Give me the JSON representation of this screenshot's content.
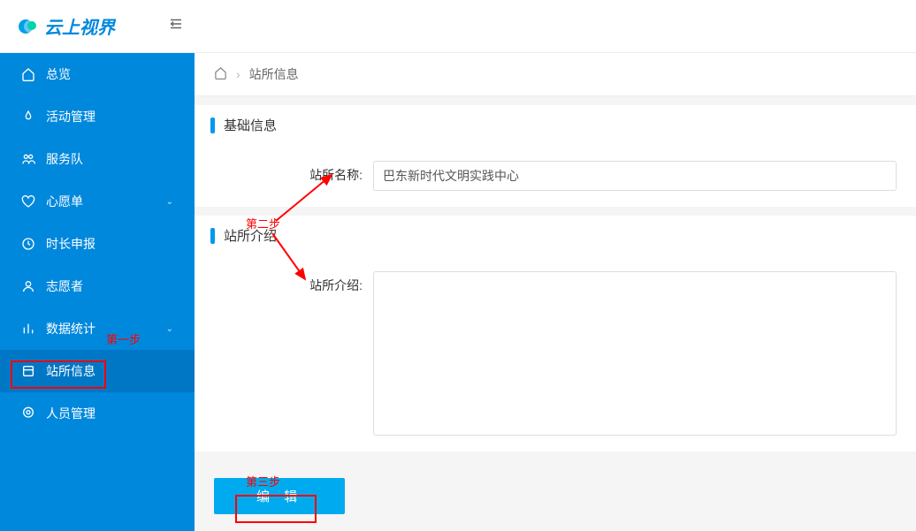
{
  "brand": {
    "name": "云上视界"
  },
  "sidebar": {
    "items": [
      {
        "label": "总览",
        "icon": "home-icon",
        "expandable": false
      },
      {
        "label": "活动管理",
        "icon": "fire-icon",
        "expandable": false
      },
      {
        "label": "服务队",
        "icon": "team-icon",
        "expandable": false
      },
      {
        "label": "心愿单",
        "icon": "heart-icon",
        "expandable": true
      },
      {
        "label": "时长申报",
        "icon": "clock-icon",
        "expandable": false
      },
      {
        "label": "志愿者",
        "icon": "user-icon",
        "expandable": false
      },
      {
        "label": "数据统计",
        "icon": "chart-icon",
        "expandable": true
      },
      {
        "label": "站所信息",
        "icon": "site-icon",
        "expandable": false
      },
      {
        "label": "人员管理",
        "icon": "people-icon",
        "expandable": false
      }
    ]
  },
  "breadcrumb": {
    "home": "⌂",
    "current": "站所信息"
  },
  "sections": {
    "basic_title": "基础信息",
    "intro_title": "站所介绍"
  },
  "form": {
    "name_label": "站所名称:",
    "name_value": "巴东新时代文明实践中心",
    "intro_label": "站所介绍:",
    "intro_value": ""
  },
  "actions": {
    "edit_label": "编 辑"
  },
  "annotations": {
    "step1": "第一步",
    "step2": "第二步",
    "step3": "第三步"
  }
}
